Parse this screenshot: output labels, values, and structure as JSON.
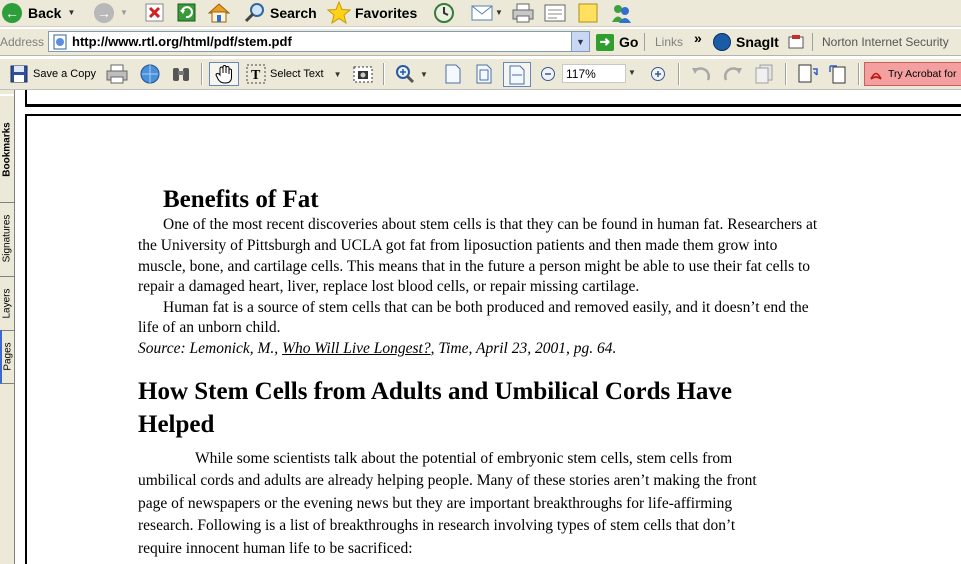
{
  "ie_toolbar": {
    "back_label": "Back",
    "search_label": "Search",
    "favorites_label": "Favorites"
  },
  "address_bar": {
    "label": "Address",
    "url": "http://www.rtl.org/html/pdf/stem.pdf",
    "go_label": "Go",
    "links_label": "Links",
    "chevron": "»",
    "snagit_label": "SnagIt",
    "norton_label": "Norton Internet Security"
  },
  "acrobat_toolbar": {
    "save_copy_label": "Save a Copy",
    "select_text_label": "Select Text",
    "zoom_value": "117%",
    "try_acrobat_label": "Try Acrobat for"
  },
  "side_tabs": [
    "Bookmarks",
    "Signatures",
    "Layers",
    "Pages"
  ],
  "document": {
    "heading1": "Benefits of Fat",
    "para1_lines": [
      "One of the most recent discoveries about stem cells is that they can be found in human fat.  Researchers at",
      "the University of Pittsburgh and UCLA got fat from liposuction patients and then made them grow into",
      "muscle, bone, and cartilage cells.  This means that in the future a person might be able to use their fat cells to",
      "repair a damaged heart, liver, replace lost blood cells, or repair missing cartilage."
    ],
    "para2_lines": [
      "Human fat is a source of stem cells that can be both produced and removed easily, and it doesn’t end the",
      "life of an unborn child."
    ],
    "source": {
      "prefix": "Source: Lemonick, M., ",
      "title": "Who Will Live Longest?",
      "suffix": ", Time, April 23, 2001, pg. 64."
    },
    "heading2_lines": [
      "How Stem Cells from Adults and Umbilical Cords Have",
      "Helped"
    ],
    "para3_lines": [
      "While some scientists talk about the potential of embryonic stem cells, stem cells from",
      "umbilical cords and adults are already helping people.  Many of these stories aren’t making the front",
      "page of newspapers or the evening news but they are important breakthroughs for life-affirming",
      "research.  Following is a list of breakthroughs in research involving types of stem cells that don’t",
      "require innocent human life to be sacrificed:"
    ]
  },
  "colors": {
    "chrome": "#ece9d8",
    "go_green": "#2f9e2f",
    "try_acrobat_bg": "#f4a0a0"
  }
}
